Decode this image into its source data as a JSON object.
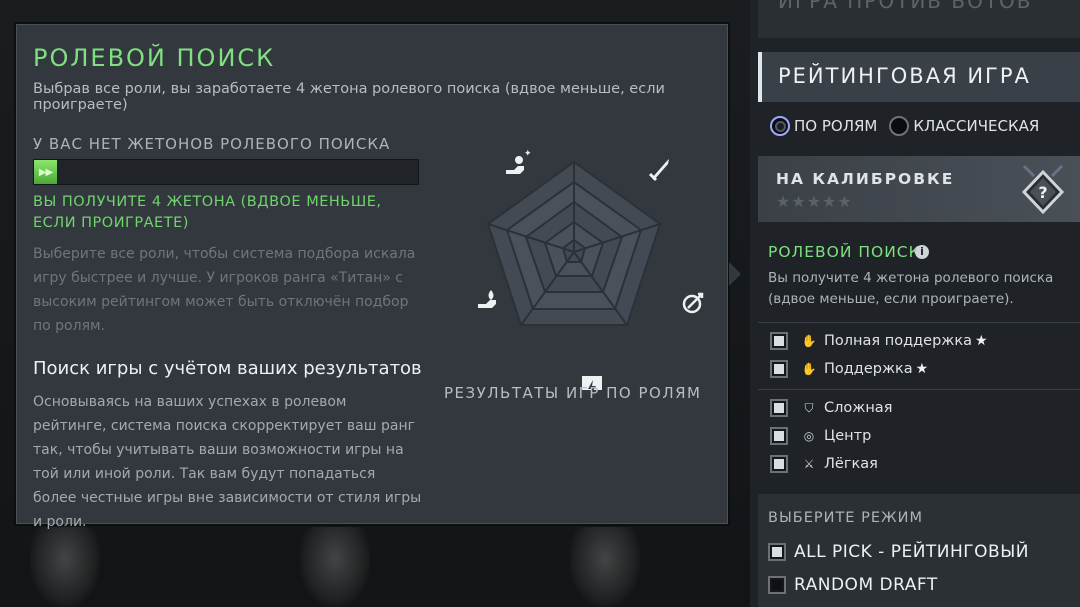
{
  "popup": {
    "title": "РОЛЕВОЙ ПОИСК",
    "subtitle": "Выбрав все роли, вы заработаете 4 жетона ролевого поиска (вдвое меньше, если проиграете)",
    "tokens_label": "У ВАС НЕТ ЖЕТОНОВ РОЛЕВОГО ПОИСКА",
    "progress": 0.06,
    "reward_text": "ВЫ ПОЛУЧИТЕ 4 ЖЕТОНА (ВДВОЕ МЕНЬШЕ, ЕСЛИ ПРОИГРАЕТЕ)",
    "hint_text": "Выберите все роли, чтобы система подбора искала игру быстрее и лучше. У игроков ранга «Титан» с высоким рейтингом может быть отключён подбор по ролям.",
    "section_title": "Поиск игры с учётом ваших результатов",
    "section_body": "Основываясь на ваших успехах в ролевом рейтинге, система поиска скорректирует ваш ранг так, чтобы учитывать ваши возможности игры на той или иной роли. Так вам будут попадаться более честные игры вне зависимости от стиля игры и роли.",
    "radar_caption": "РЕЗУЛЬТАТЫ ИГР ПО РОЛЯМ",
    "radar_axes": [
      "hard-support-icon",
      "carry-icon",
      "mid-icon",
      "offlane-icon",
      "soft-support-icon"
    ]
  },
  "sidebar": {
    "vs_bots": "ИГРА ПРОТИВ БОТОВ",
    "ranked_title": "РЕЙТИНГОВАЯ ИГРА",
    "search_modes": [
      {
        "label": "ПО РОЛЯМ",
        "selected": true
      },
      {
        "label": "КЛАССИЧЕСКАЯ",
        "selected": false
      }
    ],
    "calibration": {
      "title": "НА КАЛИБРОВКЕ",
      "stars": "★★★★★",
      "medal": "?"
    },
    "role_search": {
      "title": "РОЛЕВОЙ ПОИСК",
      "info": "i",
      "desc": "Вы получите 4 жетона ролевого поиска (вдвое меньше, если проиграете)."
    },
    "roles": [
      {
        "label": "Полная поддержка",
        "starred": true,
        "checked": true,
        "icon": "hard-support-icon"
      },
      {
        "label": "Поддержка",
        "starred": true,
        "checked": true,
        "icon": "soft-support-icon"
      },
      {
        "label": "Сложная",
        "starred": false,
        "checked": true,
        "icon": "offlane-icon"
      },
      {
        "label": "Центр",
        "starred": false,
        "checked": true,
        "icon": "mid-icon"
      },
      {
        "label": "Лёгкая",
        "starred": false,
        "checked": true,
        "icon": "carry-icon"
      }
    ],
    "select_mode": {
      "title": "ВЫБЕРИТЕ РЕЖИМ",
      "items": [
        {
          "label": "ALL PICK - РЕЙТИНГОВЫЙ",
          "checked": true
        },
        {
          "label": "RANDOM DRAFT",
          "checked": false
        }
      ]
    }
  },
  "colors": {
    "accent_green": "#7fe07f",
    "panel": "#33383f",
    "sidebar": "#1f2327"
  }
}
